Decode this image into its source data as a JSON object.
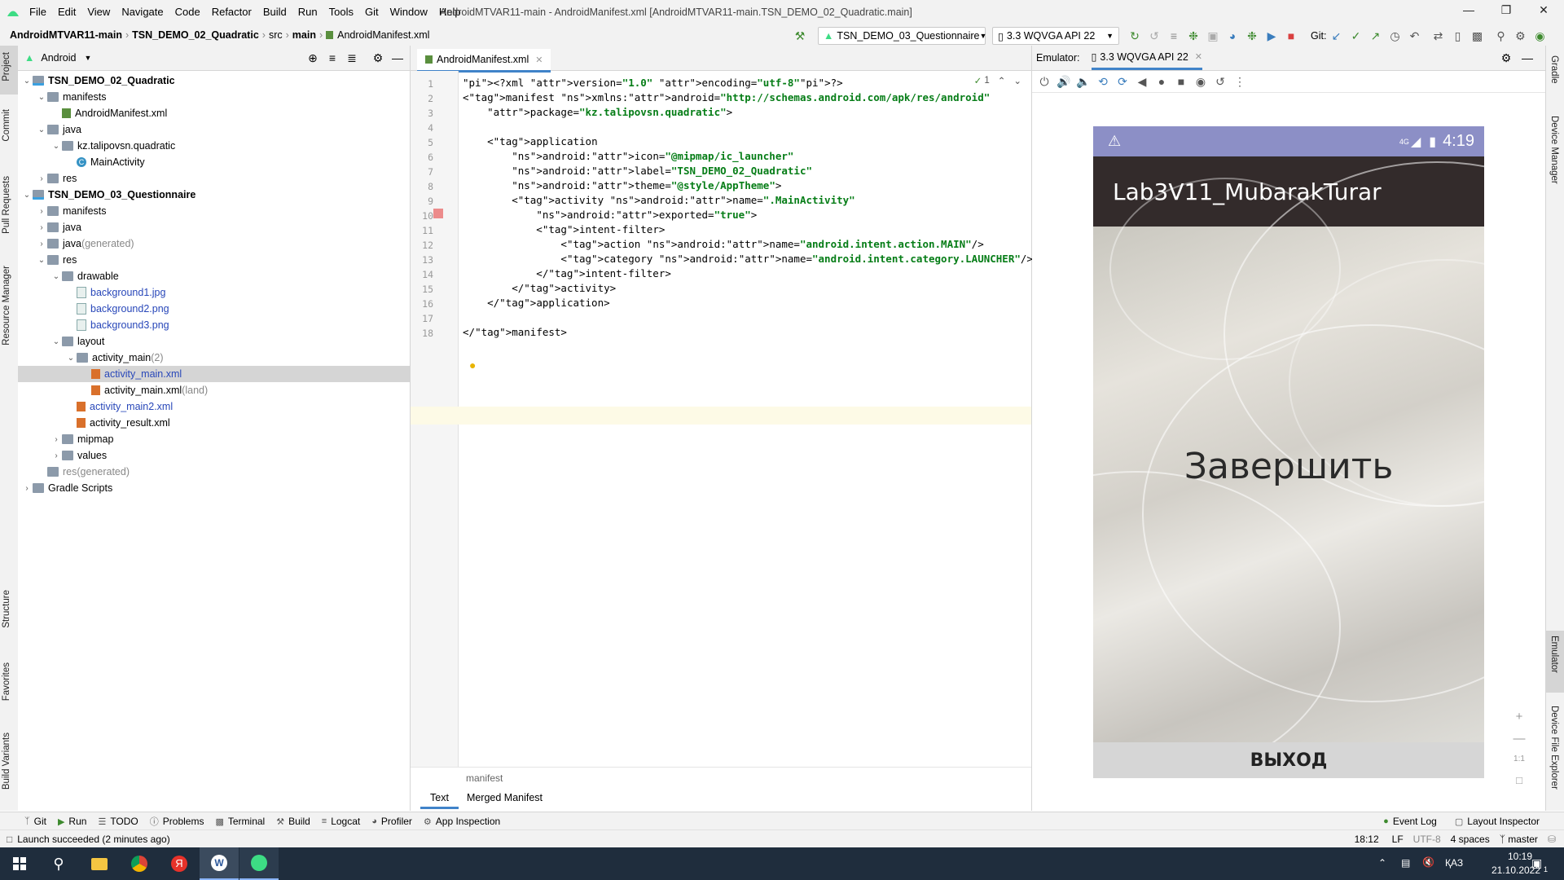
{
  "menu": [
    "File",
    "Edit",
    "View",
    "Navigate",
    "Code",
    "Refactor",
    "Build",
    "Run",
    "Tools",
    "Git",
    "Window",
    "Help"
  ],
  "window_title": "AndroidMTVAR11-main - AndroidManifest.xml [AndroidMTVAR11-main.TSN_DEMO_02_Quadratic.main]",
  "breadcrumbs": [
    "AndroidMTVAR11-main",
    "TSN_DEMO_02_Quadratic",
    "src",
    "main",
    "AndroidManifest.xml"
  ],
  "toolbar": {
    "run_config": "TSN_DEMO_03_Questionnaire",
    "device": "3.3  WQVGA API 22",
    "git_label": "Git:"
  },
  "left_strip": [
    "Project",
    "Commit",
    "Pull Requests",
    "Resource Manager",
    "Structure",
    "Favorites",
    "Build Variants"
  ],
  "project": {
    "view": "Android",
    "tree": [
      {
        "label": "TSN_DEMO_02_Quadratic",
        "indent": 0,
        "arrow": "v",
        "icon": "module",
        "bold": true
      },
      {
        "label": "manifests",
        "indent": 1,
        "arrow": "v",
        "icon": "folder"
      },
      {
        "label": "AndroidManifest.xml",
        "indent": 2,
        "arrow": "",
        "icon": "manifest"
      },
      {
        "label": "java",
        "indent": 1,
        "arrow": "v",
        "icon": "folder"
      },
      {
        "label": "kz.talipovsn.quadratic",
        "indent": 2,
        "arrow": "v",
        "icon": "folder"
      },
      {
        "label": "MainActivity",
        "indent": 3,
        "arrow": "",
        "icon": "class"
      },
      {
        "label": "res",
        "indent": 1,
        "arrow": ">",
        "icon": "folder"
      },
      {
        "label": "TSN_DEMO_03_Questionnaire",
        "indent": 0,
        "arrow": "v",
        "icon": "module",
        "bold": true
      },
      {
        "label": "manifests",
        "indent": 1,
        "arrow": ">",
        "icon": "folder"
      },
      {
        "label": "java",
        "indent": 1,
        "arrow": ">",
        "icon": "folder"
      },
      {
        "label": "java",
        "suffix": " (generated)",
        "indent": 1,
        "arrow": ">",
        "icon": "folder"
      },
      {
        "label": "res",
        "indent": 1,
        "arrow": "v",
        "icon": "folder"
      },
      {
        "label": "drawable",
        "indent": 2,
        "arrow": "v",
        "icon": "folder"
      },
      {
        "label": "background1.jpg",
        "indent": 3,
        "arrow": "",
        "icon": "image",
        "blue": true
      },
      {
        "label": "background2.png",
        "indent": 3,
        "arrow": "",
        "icon": "image",
        "blue": true
      },
      {
        "label": "background3.png",
        "indent": 3,
        "arrow": "",
        "icon": "image",
        "blue": true
      },
      {
        "label": "layout",
        "indent": 2,
        "arrow": "v",
        "icon": "folder"
      },
      {
        "label": "activity_main",
        "suffix": " (2)",
        "indent": 3,
        "arrow": "v",
        "icon": "folder"
      },
      {
        "label": "activity_main.xml",
        "indent": 4,
        "arrow": "",
        "icon": "xml",
        "blue": true,
        "selected": true
      },
      {
        "label": "activity_main.xml",
        "suffix": " (land)",
        "indent": 4,
        "arrow": "",
        "icon": "xml"
      },
      {
        "label": "activity_main2.xml",
        "indent": 3,
        "arrow": "",
        "icon": "xml",
        "blue": true
      },
      {
        "label": "activity_result.xml",
        "indent": 3,
        "arrow": "",
        "icon": "xml"
      },
      {
        "label": "mipmap",
        "indent": 2,
        "arrow": ">",
        "icon": "folder"
      },
      {
        "label": "values",
        "indent": 2,
        "arrow": ">",
        "icon": "folder"
      },
      {
        "label": "res",
        "suffix": " (generated)",
        "indent": 1,
        "arrow": "",
        "icon": "folder",
        "gray": true
      },
      {
        "label": "Gradle Scripts",
        "indent": 0,
        "arrow": ">",
        "icon": "gradle"
      }
    ]
  },
  "editor": {
    "tab": "AndroidManifest.xml",
    "inspection_count": "1",
    "breadcrumb": "manifest",
    "bottom_tabs": [
      "Text",
      "Merged Manifest"
    ],
    "lines": [
      "<?xml version=\"1.0\" encoding=\"utf-8\"?>",
      "<manifest xmlns:android=\"http://schemas.android.com/apk/res/android\"",
      "    package=\"kz.talipovsn.quadratic\">",
      "",
      "    <application",
      "        android:icon=\"@mipmap/ic_launcher\"",
      "        android:label=\"TSN_DEMO_02_Quadratic\"",
      "        android:theme=\"@style/AppTheme\">",
      "        <activity android:name=\".MainActivity\"",
      "            android:exported=\"true\">",
      "            <intent-filter>",
      "                <action android:name=\"android.intent.action.MAIN\"/>",
      "                <category android:name=\"android.intent.category.LAUNCHER\"/>",
      "            </intent-filter>",
      "        </activity>",
      "    </application>",
      "",
      "</manifest>"
    ]
  },
  "emulator": {
    "label": "Emulator:",
    "tab": "3.3 WQVGA API 22",
    "status_signal": "4G",
    "status_time": "4:19",
    "app_title": "Lab3V11_MubarakTurar",
    "main_text": "Завершить",
    "exit_button": "ВЫХОД",
    "zoom_ratio": "1:1"
  },
  "right_strip": [
    "Gradle",
    "Device Manager",
    "Emulator",
    "Device File Explorer"
  ],
  "bottom_tools": [
    "Git",
    "Run",
    "TODO",
    "Problems",
    "Terminal",
    "Build",
    "Logcat",
    "Profiler",
    "App Inspection"
  ],
  "bottom_right_tools": [
    "Event Log",
    "Layout Inspector"
  ],
  "status": {
    "message": "Launch succeeded (2 minutes ago)",
    "position": "18:12",
    "line_sep": "LF",
    "encoding": "UTF-8",
    "indent": "4 spaces",
    "branch": "master"
  },
  "taskbar": {
    "lang": "ҚАЗ",
    "time": "10:19",
    "date": "21.10.2022",
    "notif_count": "1"
  },
  "colors": {
    "accent": "#4083c9",
    "status_bar": "#8c8fc6",
    "app_bar": "#332b2b",
    "exit_button": "#d6d6d6"
  }
}
